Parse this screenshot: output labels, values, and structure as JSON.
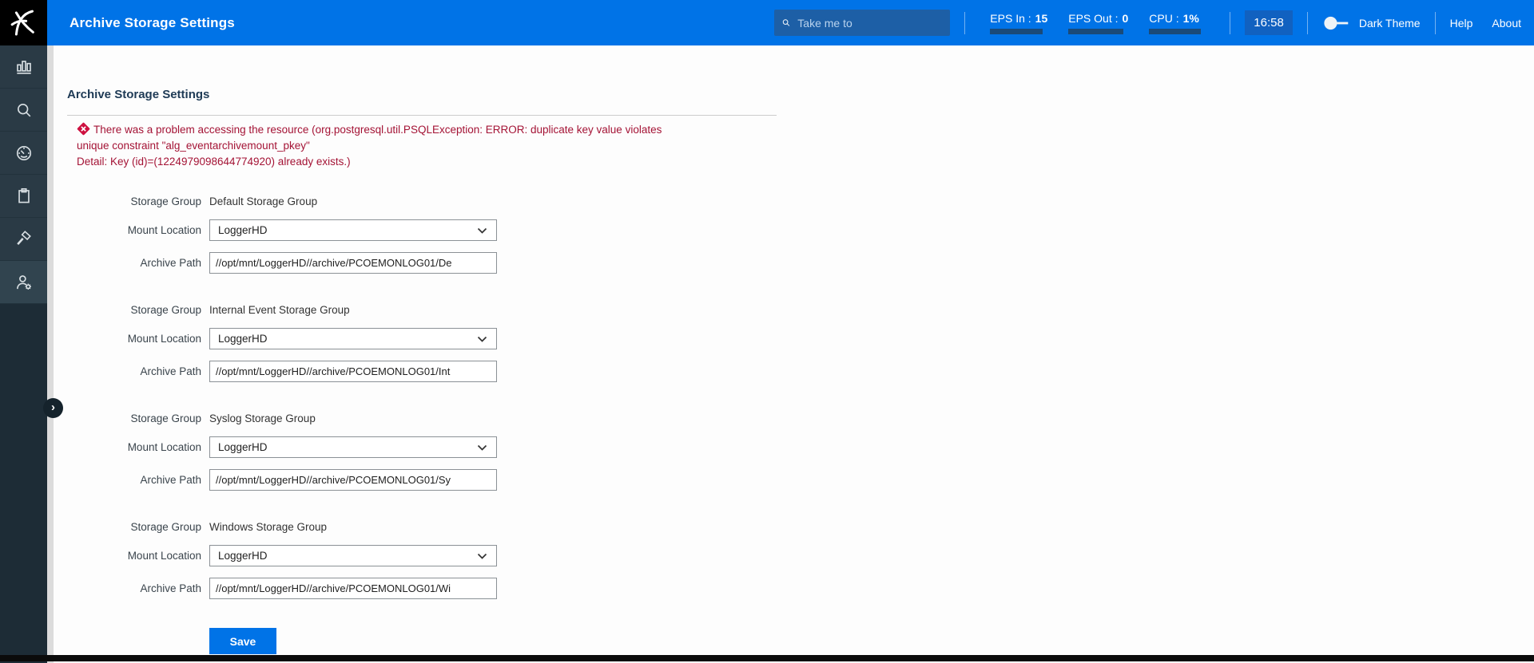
{
  "topbar": {
    "title": "Archive Storage Settings",
    "search_placeholder": "Take me to",
    "stats": [
      {
        "label": "EPS In :",
        "value": "15"
      },
      {
        "label": "EPS Out :",
        "value": "0"
      },
      {
        "label": "CPU :",
        "value": "1%"
      }
    ],
    "time": "16:58",
    "theme_toggle_label": "Dark Theme",
    "help_label": "Help",
    "about_label": "About"
  },
  "sidebar": {
    "icons": [
      "bar-chart-icon",
      "search-icon",
      "gauge-icon",
      "clipboard-icon",
      "gavel-icon",
      "user-gear-icon"
    ]
  },
  "page": {
    "heading": "Archive Storage Settings",
    "error_line1": "There was a problem accessing the resource (org.postgresql.util.PSQLException: ERROR: duplicate key value violates",
    "error_line2": "unique constraint \"alg_eventarchivemount_pkey\"",
    "error_line3": "Detail: Key (id)=(1224979098644774920) already exists.)",
    "labels": {
      "storage_group": "Storage Group",
      "mount_location": "Mount Location",
      "archive_path": "Archive Path"
    },
    "groups": [
      {
        "name": "Default Storage Group",
        "mount_location": "LoggerHD",
        "archive_path": "//opt/mnt/LoggerHD//archive/PCOEMONLOG01/De"
      },
      {
        "name": "Internal Event Storage Group",
        "mount_location": "LoggerHD",
        "archive_path": "//opt/mnt/LoggerHD//archive/PCOEMONLOG01/Int"
      },
      {
        "name": "Syslog Storage Group",
        "mount_location": "LoggerHD",
        "archive_path": "//opt/mnt/LoggerHD//archive/PCOEMONLOG01/Sy"
      },
      {
        "name": "Windows Storage Group",
        "mount_location": "LoggerHD",
        "archive_path": "//opt/mnt/LoggerHD//archive/PCOEMONLOG01/Wi"
      }
    ],
    "save_label": "Save"
  },
  "colors": {
    "topbar_blue": "#0073e7",
    "accent_blue": "#0073e7",
    "error_red": "#a41335",
    "error_icon_red": "#ce1140",
    "sidebar_dark": "#2a3a45",
    "stat_bar_navy": "#1a4a79"
  }
}
